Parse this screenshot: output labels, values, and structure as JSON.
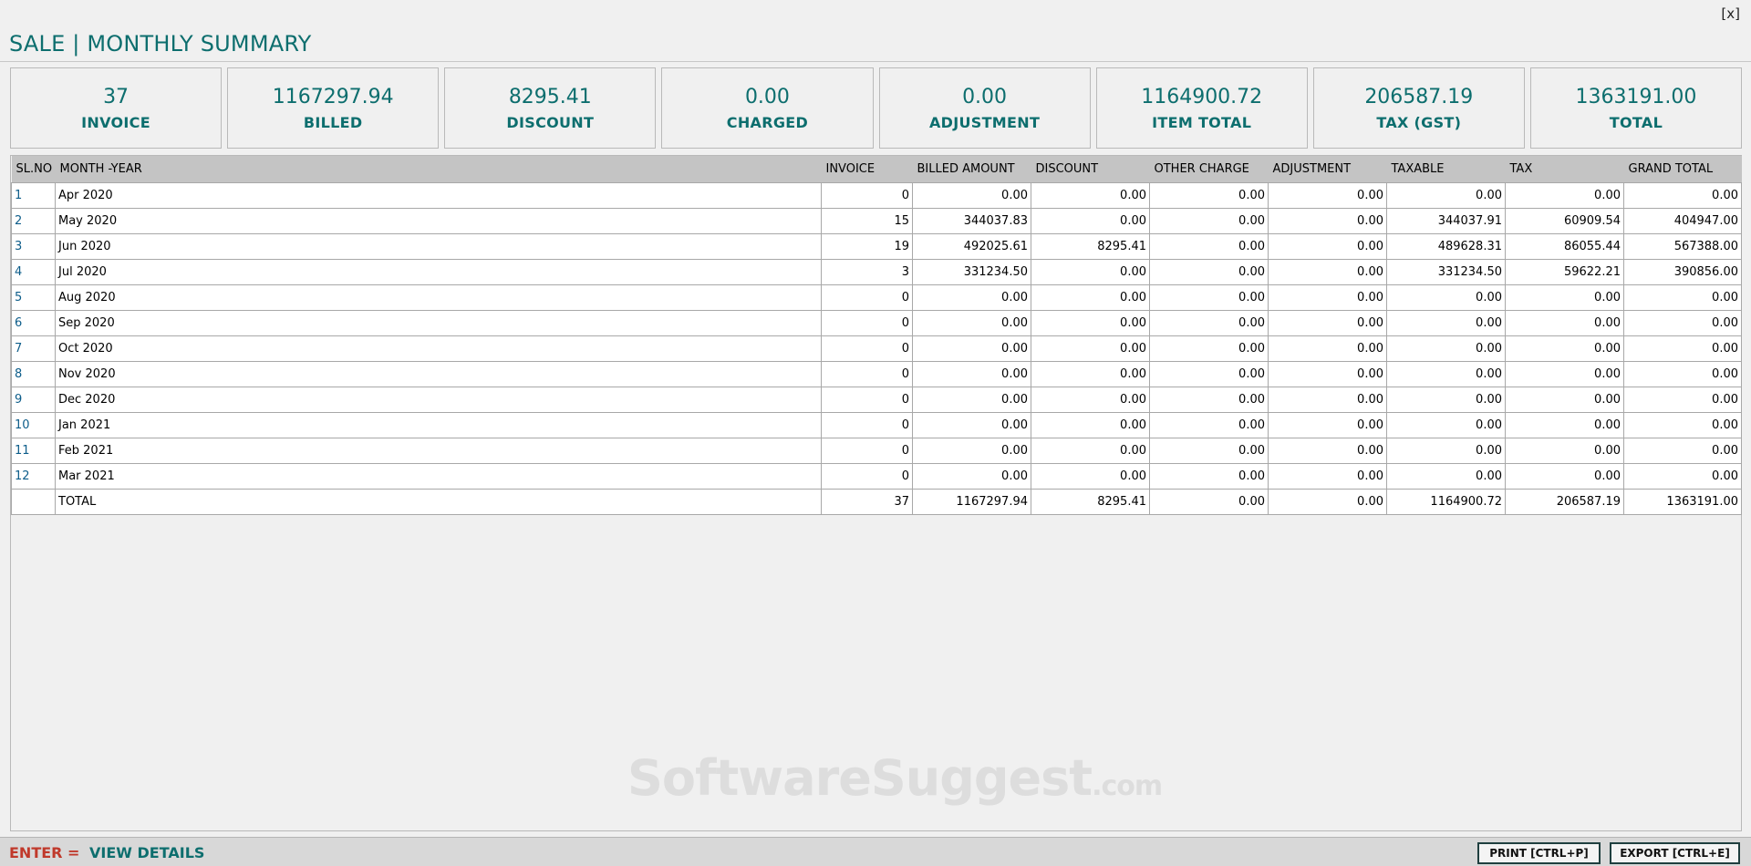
{
  "window": {
    "close_label": "[x]",
    "title": "SALE | MONTHLY SUMMARY"
  },
  "summary_cards": [
    {
      "value": "37",
      "label": "INVOICE"
    },
    {
      "value": "1167297.94",
      "label": "BILLED"
    },
    {
      "value": "8295.41",
      "label": "DISCOUNT"
    },
    {
      "value": "0.00",
      "label": "CHARGED"
    },
    {
      "value": "0.00",
      "label": "ADJUSTMENT"
    },
    {
      "value": "1164900.72",
      "label": "ITEM TOTAL"
    },
    {
      "value": "206587.19",
      "label": "TAX (GST)"
    },
    {
      "value": "1363191.00",
      "label": "TOTAL"
    }
  ],
  "table": {
    "columns": [
      "SL.NO",
      "MONTH -YEAR",
      "INVOICE",
      "BILLED AMOUNT",
      "DISCOUNT",
      "OTHER CHARGE",
      "ADJUSTMENT",
      "TAXABLE",
      "TAX",
      "GRAND TOTAL"
    ],
    "rows": [
      [
        "1",
        "Apr 2020",
        "0",
        "0.00",
        "0.00",
        "0.00",
        "0.00",
        "0.00",
        "0.00",
        "0.00"
      ],
      [
        "2",
        "May 2020",
        "15",
        "344037.83",
        "0.00",
        "0.00",
        "0.00",
        "344037.91",
        "60909.54",
        "404947.00"
      ],
      [
        "3",
        "Jun 2020",
        "19",
        "492025.61",
        "8295.41",
        "0.00",
        "0.00",
        "489628.31",
        "86055.44",
        "567388.00"
      ],
      [
        "4",
        "Jul 2020",
        "3",
        "331234.50",
        "0.00",
        "0.00",
        "0.00",
        "331234.50",
        "59622.21",
        "390856.00"
      ],
      [
        "5",
        "Aug 2020",
        "0",
        "0.00",
        "0.00",
        "0.00",
        "0.00",
        "0.00",
        "0.00",
        "0.00"
      ],
      [
        "6",
        "Sep 2020",
        "0",
        "0.00",
        "0.00",
        "0.00",
        "0.00",
        "0.00",
        "0.00",
        "0.00"
      ],
      [
        "7",
        "Oct 2020",
        "0",
        "0.00",
        "0.00",
        "0.00",
        "0.00",
        "0.00",
        "0.00",
        "0.00"
      ],
      [
        "8",
        "Nov 2020",
        "0",
        "0.00",
        "0.00",
        "0.00",
        "0.00",
        "0.00",
        "0.00",
        "0.00"
      ],
      [
        "9",
        "Dec 2020",
        "0",
        "0.00",
        "0.00",
        "0.00",
        "0.00",
        "0.00",
        "0.00",
        "0.00"
      ],
      [
        "10",
        "Jan 2021",
        "0",
        "0.00",
        "0.00",
        "0.00",
        "0.00",
        "0.00",
        "0.00",
        "0.00"
      ],
      [
        "11",
        "Feb 2021",
        "0",
        "0.00",
        "0.00",
        "0.00",
        "0.00",
        "0.00",
        "0.00",
        "0.00"
      ],
      [
        "12",
        "Mar 2021",
        "0",
        "0.00",
        "0.00",
        "0.00",
        "0.00",
        "0.00",
        "0.00",
        "0.00"
      ]
    ],
    "total_row": [
      "",
      "TOTAL",
      "37",
      "1167297.94",
      "8295.41",
      "0.00",
      "0.00",
      "1164900.72",
      "206587.19",
      "1363191.00"
    ]
  },
  "watermark": {
    "text": "SoftwareSuggest",
    "suffix": ".com"
  },
  "footer": {
    "hint_key": "ENTER =",
    "hint_text": "VIEW DETAILS",
    "print_label": "PRINT [CTRL+P]",
    "export_label": "EXPORT [CTRL+E]"
  },
  "colors": {
    "accent_teal": "#0d6e6e",
    "hint_red": "#c0392b",
    "header_gray": "#c4c4c4"
  }
}
